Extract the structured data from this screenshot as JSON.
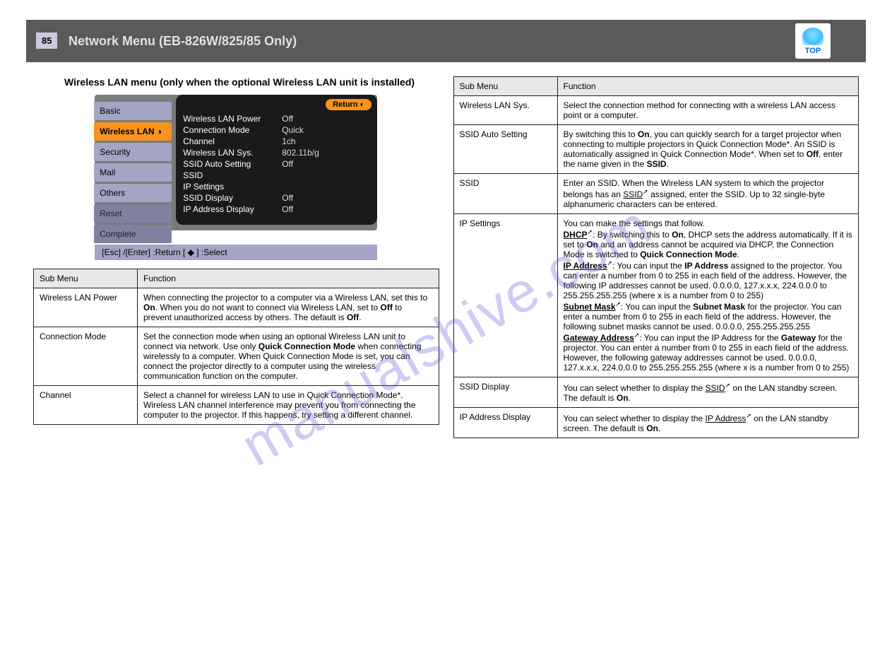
{
  "watermark": "manualshive.com",
  "header": {
    "page_no": "85",
    "title": "Network Menu (EB-826W/825/85 Only)",
    "top_label": "TOP"
  },
  "section_title": "Wireless LAN menu (only when the optional Wireless LAN unit is installed)",
  "menu": {
    "tabs": [
      "Basic",
      "Wireless LAN",
      "Security",
      "Mail",
      "Others",
      "Reset",
      "Complete"
    ],
    "active_index": 1,
    "return": "Return",
    "rows": [
      {
        "k": "Wireless LAN Power",
        "v": "Off"
      },
      {
        "k": "Connection Mode",
        "v": "Quick"
      },
      {
        "k": "Channel",
        "v": "1ch"
      },
      {
        "k": "Wireless LAN Sys.",
        "v": "802.11b/g"
      },
      {
        "k": "SSID Auto Setting",
        "v": "Off"
      },
      {
        "k": "SSID",
        "v": ""
      },
      {
        "k": "IP Settings",
        "v": ""
      },
      {
        "k": "SSID Display",
        "v": "Off"
      },
      {
        "k": "IP Address Display",
        "v": "Off"
      }
    ],
    "hint": "[Esc] /[Enter] :Return  [ ◆ ] :Select"
  },
  "left_table": {
    "head": [
      "Sub Menu",
      "Function"
    ],
    "rows": [
      {
        "sub": "Wireless LAN Power",
        "fn": "When connecting the projector to a computer via a Wireless LAN, set this to <b>On</b>. When you do not want to connect via Wireless LAN, set to <b>Off</b> to prevent unauthorized access by others. The default is <b>Off</b>."
      },
      {
        "sub": "Connection Mode",
        "fn": "Set the connection mode when using an optional Wireless LAN unit to connect via network. Use only <b>Quick Connection Mode</b> when connecting wirelessly to a computer. When Quick Connection Mode is set, you can connect the projector directly to a computer using the wireless communication function on the computer."
      },
      {
        "sub": "Channel",
        "fn": "Select a channel for wireless LAN to use in Quick Connection Mode*. Wireless LAN channel interference may prevent you from connecting the computer to the projector. If this happens, try setting a different channel."
      }
    ]
  },
  "right_table": {
    "head": [
      "Sub Menu",
      "Function"
    ],
    "rows": [
      {
        "sub": "Wireless LAN Sys.",
        "fn": "Select the connection method for connecting with a wireless LAN access point or a computer."
      },
      {
        "sub": "SSID Auto Setting",
        "fn": "By switching this to <b>On</b>, you can quickly search for a target projector when connecting to multiple projectors in Quick Connection Mode*. An SSID is automatically assigned in Quick Connection Mode*. When set to <b>Off</b>, enter the name given in the <b>SSID</b>."
      },
      {
        "sub": "SSID",
        "fn_pre": "Enter an SSID. When the Wireless LAN system to which the projector belongs has an ",
        "fn_link": "SSID",
        "fn_sup": "➚",
        "fn_post": " assigned, enter the SSID. Up to 32 single-byte alphanumeric characters can be entered."
      },
      {
        "sub": "IP Settings",
        "fn_blocks": [
          "You can make the settings that follow.",
          {
            "label": "DHCP",
            "glossary": true,
            "body": ": By switching this to <b>On</b>, DHCP sets the address automatically. If it is set to <b>On</b> and an address cannot be acquired via DHCP, the Connection Mode is switched to <b>Quick Connection Mode</b>."
          },
          {
            "label": "IP Address",
            "glossary": true,
            "body": ": You can input the <b>IP Address</b> assigned to the projector. You can enter a number from 0 to 255 in each field of the address. However, the following IP addresses cannot be used. 0.0.0.0, 127.x.x.x, 224.0.0.0 to 255.255.255.255 (where x is a number from 0 to 255)"
          },
          {
            "label": "Subnet Mask",
            "glossary": true,
            "body": ": You can input the <b>Subnet Mask</b> for the projector. You can enter a number from 0 to 255 in each field of the address. However, the following subnet masks cannot be used. 0.0.0.0, 255.255.255.255"
          },
          {
            "label": "Gateway Address",
            "glossary": true,
            "body": ": You can input the IP Address for the <b>Gateway</b> for the projector. You can enter a number from 0 to 255 in each field of the address. However, the following gateway addresses cannot be used. 0.0.0.0, 127.x.x.x, 224.0.0.0 to 255.255.255.255 (where x is a number from 0 to 255)"
          }
        ]
      },
      {
        "sub": "SSID Display",
        "fn_pre": "You can select whether to display the ",
        "fn_link": "SSID",
        "fn_sup": "➚",
        "fn_post": " on the LAN standby screen. The default is <b>On</b>."
      },
      {
        "sub": "IP Address Display",
        "fn_pre": "You can select whether to display the ",
        "fn_link": "IP Address",
        "fn_sup": "➚",
        "fn_post": " on the LAN standby screen. The default is <b>On</b>."
      }
    ]
  }
}
